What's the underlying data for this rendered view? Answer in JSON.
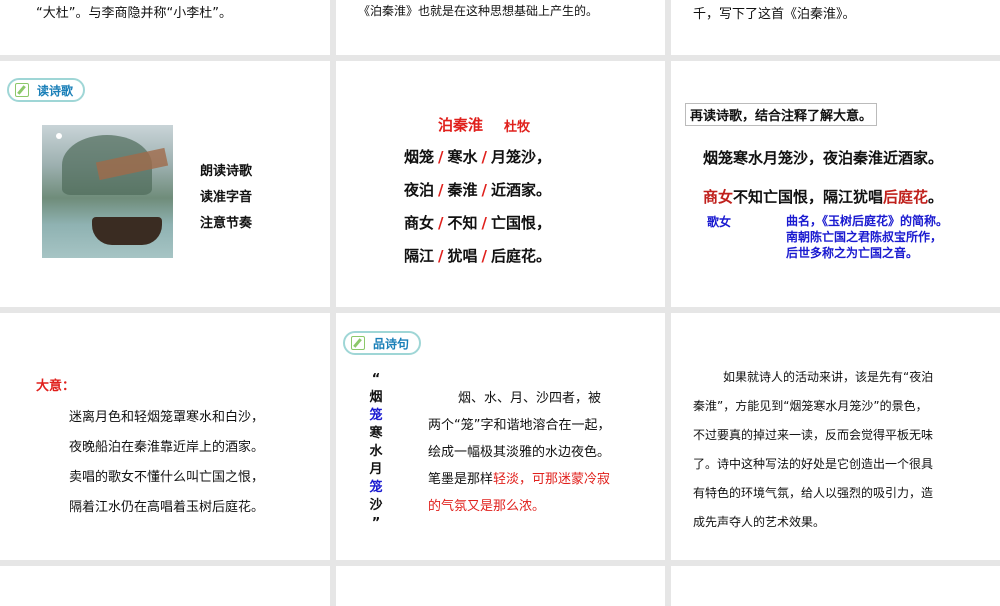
{
  "row1": {
    "s1": "“大杜”。与李商隐并称“小李杜”。",
    "s2": "《泊秦淮》也就是在这种思想基础上产生的。",
    "s3": "千，写下了这首《泊秦淮》。"
  },
  "slide4": {
    "badge": "读诗歌",
    "items": [
      "朗读诗歌",
      "读准字音",
      "注意节奏"
    ]
  },
  "slide5": {
    "title": "泊秦淮",
    "author": "杜牧",
    "lines": [
      [
        "烟笼",
        "寒水",
        "月笼沙，"
      ],
      [
        "夜泊",
        "秦淮",
        "近酒家。"
      ],
      [
        "商女",
        "不知",
        "亡国恨，"
      ],
      [
        "隔江",
        "犹唱",
        "后庭花。"
      ]
    ],
    "slash": "/"
  },
  "slide6": {
    "heading": "再读诗歌，结合注释了解大意。",
    "line1": "烟笼寒水月笼沙，夜泊秦淮近酒家。",
    "line2_a": "商女",
    "line2_b": "不知亡国恨，隔江犹唱",
    "line2_c": "后庭花",
    "line2_d": "。",
    "note1": "歌女",
    "note2": [
      "曲名，《玉树后庭花》的简称。",
      "南朝陈亡国之君陈叔宝所作，",
      "后世多称之为亡国之音。"
    ]
  },
  "slide7": {
    "label": "大意：",
    "lines": [
      "迷离月色和轻烟笼罩寒水和白沙，",
      "夜晚船泊在秦淮靠近岸上的酒家。",
      "卖唱的歌女不懂什么叫亡国之恨，",
      "隔着江水仍在高唱着玉树后庭花。"
    ]
  },
  "slide8": {
    "badge": "品诗句",
    "vertical": [
      "“",
      "烟",
      "笼",
      "寒",
      "水",
      "月",
      "笼",
      "沙",
      "”"
    ],
    "p1": "烟、水、月、沙四者，被",
    "p2": "两个“笼”字和谐地溶合在一起，",
    "p3": "绘成一幅极其淡雅的水边夜色。",
    "p4a": "笔墨是那样",
    "p4b": "轻淡，可那迷蒙冷寂",
    "p5": "的气氛又是那么浓。"
  },
  "slide9": {
    "lines": [
      "如果就诗人的活动来讲，该是先有“夜泊",
      "秦淮”，方能见到“烟笼寒水月笼沙”的景色，",
      "不过要真的掉过来一读，反而会觉得平板无味",
      "了。诗中这种写法的好处是它创造出一个很具",
      "有特色的环境气氛，给人以强烈的吸引力，造",
      "成先声夺人的艺术效果。"
    ]
  }
}
